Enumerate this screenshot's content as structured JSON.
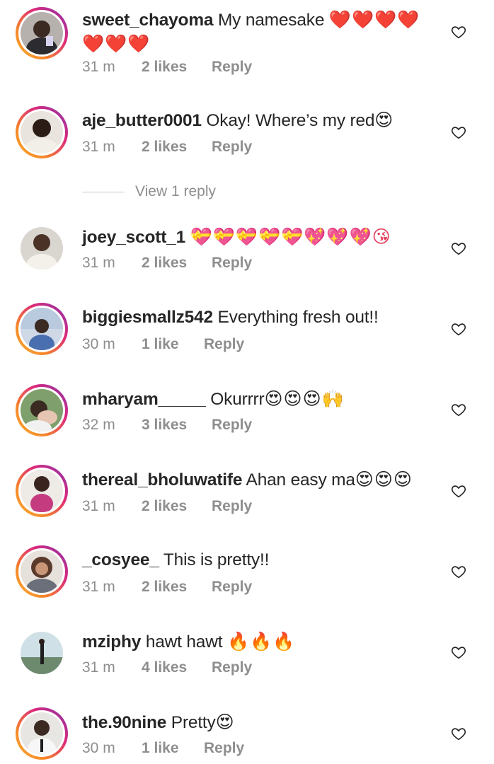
{
  "view_replies": {
    "label": "View 1 reply"
  },
  "comments": [
    {
      "username": "sweet_chayoma",
      "text": "My namesake",
      "emoji": "❤️❤️❤️❤️❤️❤️❤️",
      "time": "31 m",
      "likes": "2 likes",
      "reply": "Reply"
    },
    {
      "username": "aje_butter0001",
      "text": "Okay! Where’s my red",
      "emoji": "😍",
      "time": "31 m",
      "likes": "2 likes",
      "reply": "Reply"
    },
    {
      "username": "joey_scott_1",
      "text": "",
      "emoji": "💝💝💝💝💝💖💖💖😘",
      "time": "31 m",
      "likes": "2 likes",
      "reply": "Reply"
    },
    {
      "username": "biggiesmallz542",
      "text": "Everything fresh out!!",
      "emoji": "",
      "time": "30 m",
      "likes": "1 like",
      "reply": "Reply"
    },
    {
      "username": "mharyam_____",
      "text": "Okurrrr",
      "emoji": "😍😍😍🙌",
      "time": "32 m",
      "likes": "3 likes",
      "reply": "Reply"
    },
    {
      "username": "thereal_bholuwatife",
      "text": "Ahan easy ma",
      "emoji": "😍😍😍",
      "time": "31 m",
      "likes": "2 likes",
      "reply": "Reply"
    },
    {
      "username": "_cosyee_",
      "text": "This is pretty!!",
      "emoji": "",
      "time": "31 m",
      "likes": "2 likes",
      "reply": "Reply"
    },
    {
      "username": "mziphy",
      "text": "hawt hawt",
      "emoji": "🔥🔥🔥",
      "time": "31 m",
      "likes": "4 likes",
      "reply": "Reply"
    },
    {
      "username": "the.90nine",
      "text": "Pretty",
      "emoji": "😍",
      "time": "30 m",
      "likes": "1 like",
      "reply": "Reply"
    }
  ]
}
